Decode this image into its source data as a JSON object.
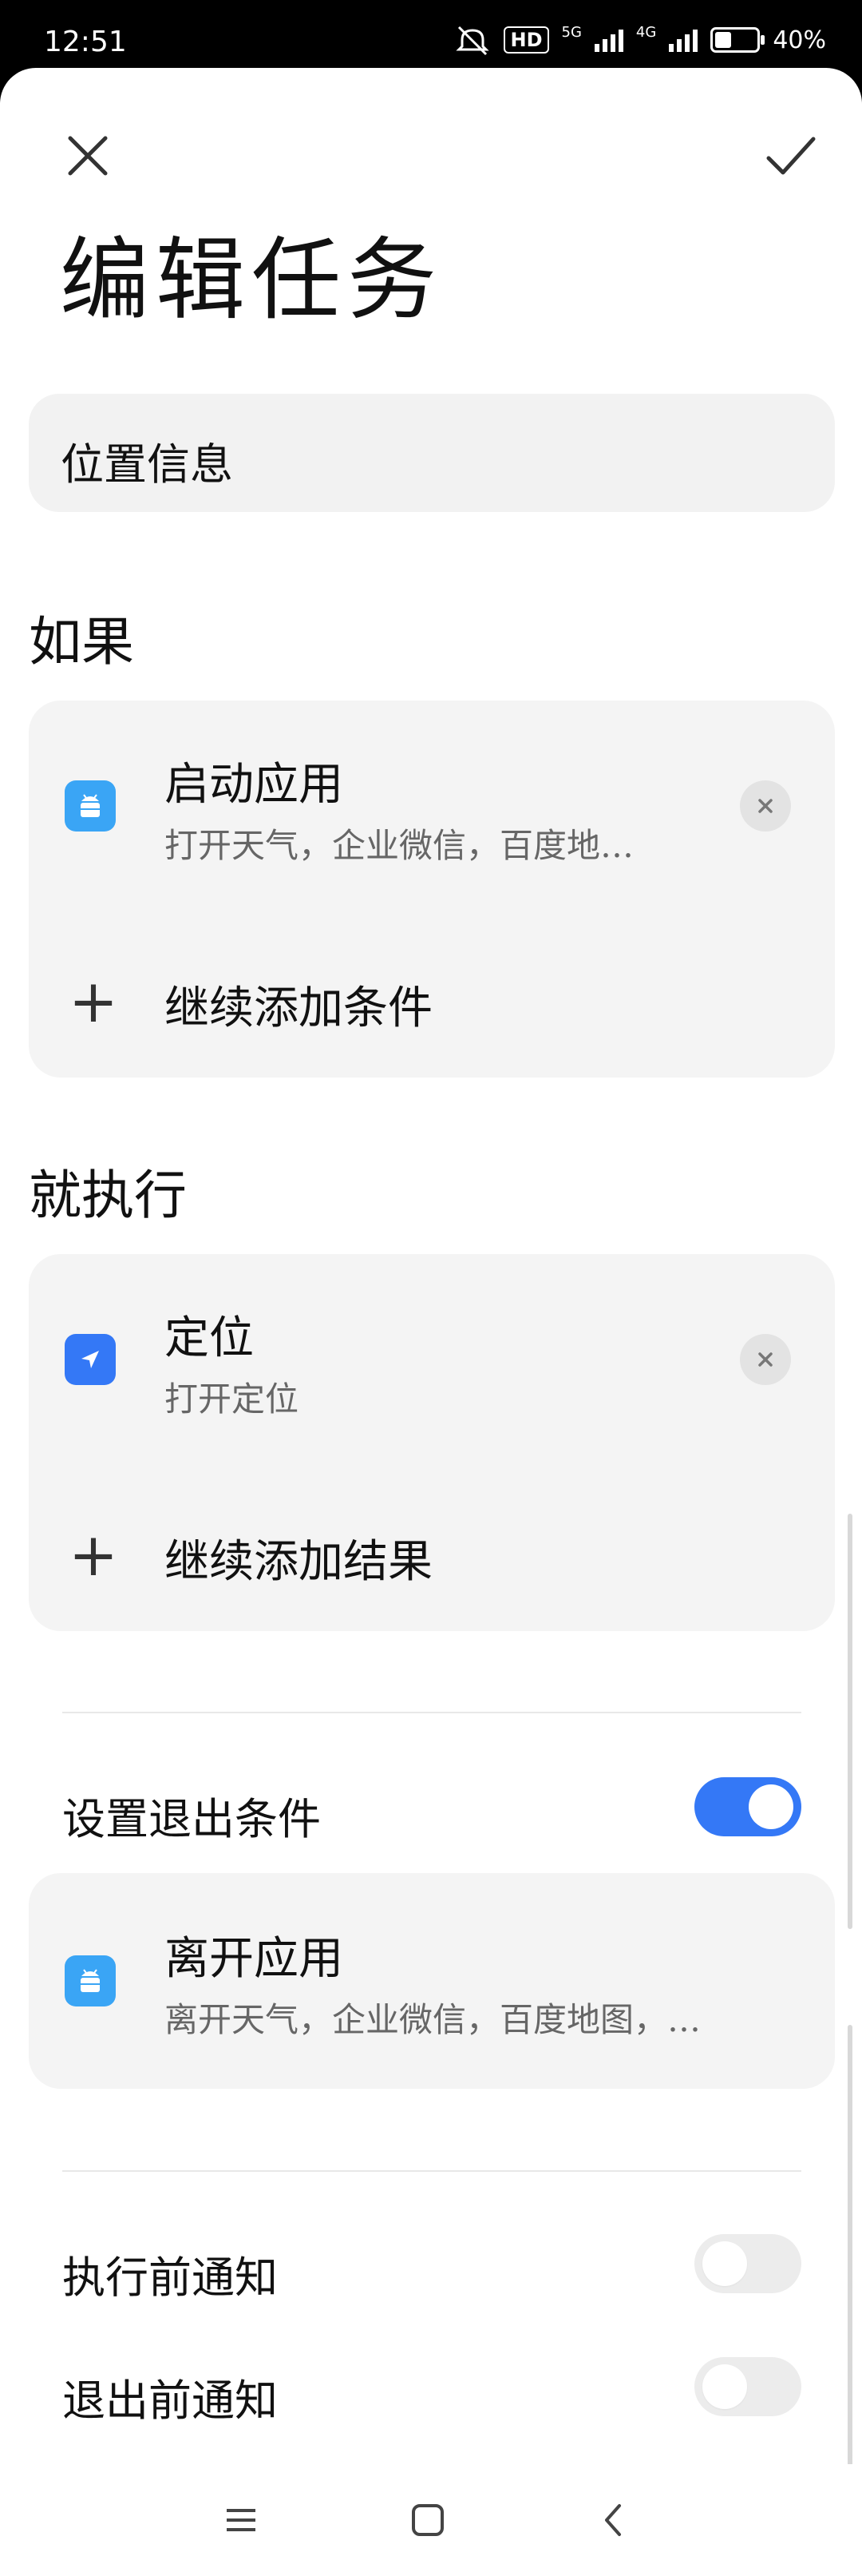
{
  "status_bar": {
    "time": "12:51",
    "hd_label": "HD",
    "net1": "5G",
    "net2": "4G",
    "battery": "40%",
    "icons": [
      "mute-icon",
      "hd-icon",
      "signal-5g-icon",
      "signal-4g-icon",
      "battery-icon"
    ]
  },
  "header": {
    "close_icon": "close-icon",
    "confirm_icon": "check-icon",
    "title": "编辑任务"
  },
  "task_name": "位置信息",
  "if_section": {
    "title": "如果",
    "items": [
      {
        "icon": "android-app-icon",
        "title": "启动应用",
        "subtitle": "打开天气，企业微信，百度地…"
      }
    ],
    "add_label": "继续添加条件"
  },
  "then_section": {
    "title": "就执行",
    "items": [
      {
        "icon": "location-arrow-icon",
        "title": "定位",
        "subtitle": "打开定位"
      }
    ],
    "add_label": "继续添加结果"
  },
  "exit": {
    "label": "设置退出条件",
    "enabled": true,
    "item": {
      "icon": "android-app-icon",
      "title": "离开应用",
      "subtitle": "离开天气，企业微信，百度地图，…"
    }
  },
  "notify": [
    {
      "label": "执行前通知",
      "enabled": false
    },
    {
      "label": "退出前通知",
      "enabled": false
    }
  ],
  "colors": {
    "accent": "#3478f6",
    "app_icon": "#3aa5f5",
    "location_icon": "#3478f6"
  },
  "navbar": [
    "menu-icon",
    "home-icon",
    "back-icon"
  ]
}
